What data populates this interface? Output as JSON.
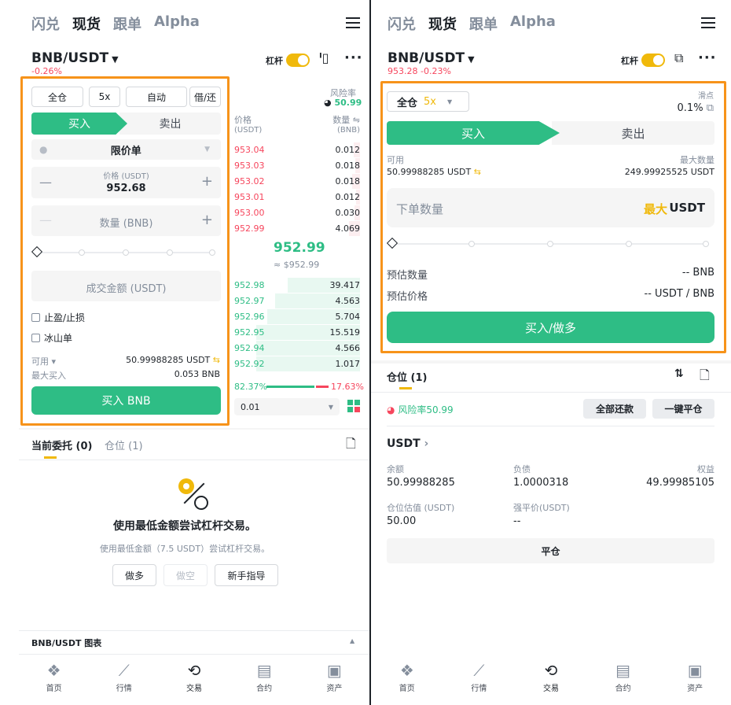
{
  "s1": {
    "tabs": [
      "闪兑",
      "现货",
      "跟单",
      "Alpha"
    ],
    "pair": "BNB/USDT",
    "change": "-0.26%",
    "lever_label": "杠杆",
    "seg": [
      "全仓",
      "5x",
      "自动",
      "借/还"
    ],
    "risk_label": "风险率",
    "risk_value": "50.99",
    "buy": "买入",
    "sell": "卖出",
    "order_type": "限价单",
    "price_label": "价格 (USDT)",
    "price_value": "952.68",
    "qty_placeholder": "数量 (BNB)",
    "total_placeholder": "成交金额 (USDT)",
    "tpsl": "止盈/止损",
    "iceberg": "冰山单",
    "avail_label": "可用",
    "avail_value": "50.99988285 USDT",
    "maxbuy_label": "最大买入",
    "maxbuy_value": "0.053 BNB",
    "buy_btn": "买入 BNB",
    "ob_head": {
      "price": "价格",
      "price_unit": "(USDT)",
      "qty": "数量",
      "qty_unit": "(BNB)"
    },
    "asks": [
      [
        "953.04",
        "0.012"
      ],
      [
        "953.03",
        "0.018"
      ],
      [
        "953.02",
        "0.018"
      ],
      [
        "953.01",
        "0.012"
      ],
      [
        "953.00",
        "0.030"
      ],
      [
        "952.99",
        "4.069"
      ]
    ],
    "mid_price": "952.99",
    "mid_usd": "≈ $952.99",
    "bids": [
      [
        "952.98",
        "39.417"
      ],
      [
        "952.97",
        "4.563"
      ],
      [
        "952.96",
        "5.704"
      ],
      [
        "952.95",
        "15.519"
      ],
      [
        "952.94",
        "4.566"
      ],
      [
        "952.92",
        "1.017"
      ]
    ],
    "ratio_buy": "82.37%",
    "ratio_sell": "17.63%",
    "depth": "0.01",
    "sub_tabs": [
      "当前委托 (0)",
      "仓位 (1)"
    ],
    "empty_title": "使用最低金额尝试杠杆交易。",
    "empty_desc": "使用最低金额（7.5 USDT）尝试杠杆交易。",
    "empty_btns": [
      "做多",
      "做空",
      "新手指导"
    ],
    "chart_bar": "BNB/USDT 图表"
  },
  "s2": {
    "tabs": [
      "闪兑",
      "现货",
      "跟单",
      "Alpha"
    ],
    "pair": "BNB/USDT",
    "price_change": "953.28",
    "change": "-0.23%",
    "lever_label": "杠杆",
    "mode": "全仓",
    "mult": "5x",
    "slip_label": "滑点",
    "slip_value": "0.1%",
    "buy": "买入",
    "sell": "卖出",
    "avail_label": "可用",
    "avail_value": "50.99988285 USDT",
    "maxq_label": "最大数量",
    "maxq_value": "249.99925525 USDT",
    "qty_placeholder": "下单数量",
    "max": "最大",
    "unit": "USDT",
    "est_qty_label": "预估数量",
    "est_qty_value": "-- BNB",
    "est_price_label": "预估价格",
    "est_price_value": "-- USDT / BNB",
    "buy_btn": "买入/做多",
    "pos_title": "仓位 (1)",
    "risk_label": "风险率",
    "risk_value": "50.99",
    "repay_btn": "全部还款",
    "close_all_btn": "一键平仓",
    "asset": "USDT",
    "balance_label": "余额",
    "balance_value": "50.99988285",
    "debt_label": "负债",
    "debt_value": "1.0000318",
    "equity_label": "权益",
    "equity_value": "49.99985105",
    "posval_label": "仓位估值 (USDT)",
    "posval_value": "50.00",
    "liq_label": "强平价(USDT)",
    "liq_value": "--",
    "close_btn": "平仓"
  },
  "nav": [
    "首页",
    "行情",
    "交易",
    "合约",
    "资产"
  ],
  "colors": {
    "green": "#2ebd85",
    "red": "#f6465d",
    "yellow": "#f0b90b",
    "orange": "#f7931a"
  }
}
